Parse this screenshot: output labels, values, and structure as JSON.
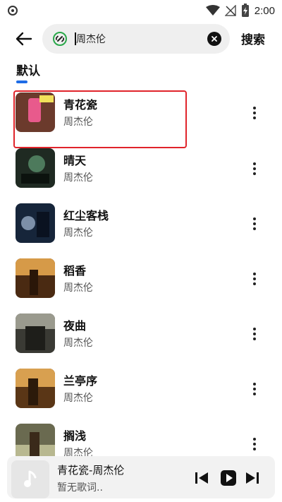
{
  "status_bar": {
    "time": "2:00"
  },
  "search": {
    "query": "周杰伦",
    "submit_label": "搜索"
  },
  "tabs": [
    {
      "label": "默认"
    }
  ],
  "songs": [
    {
      "title": "青花瓷",
      "artist": "周杰伦",
      "cover_color": "#6b3a2c",
      "cover_accent": "#e85a8c"
    },
    {
      "title": "晴天",
      "artist": "周杰伦",
      "cover_color": "#1f2a22",
      "cover_accent": "#4d7a5c"
    },
    {
      "title": "红尘客栈",
      "artist": "周杰伦",
      "cover_color": "#16253a",
      "cover_accent": "#7c8fa8"
    },
    {
      "title": "稻香",
      "artist": "周杰伦",
      "cover_color": "#4a2a12",
      "cover_accent": "#d69a48"
    },
    {
      "title": "夜曲",
      "artist": "周杰伦",
      "cover_color": "#3a3a34",
      "cover_accent": "#9a9a8e"
    },
    {
      "title": "兰亭序",
      "artist": "周杰伦",
      "cover_color": "#5a3616",
      "cover_accent": "#d8a050"
    },
    {
      "title": "搁浅",
      "artist": "周杰伦",
      "cover_color": "#6a6a50",
      "cover_accent": "#b8b890"
    }
  ],
  "player": {
    "now_playing": "青花瓷-周杰伦",
    "lyrics": "暂无歌词.."
  },
  "colors": {
    "tab_accent": "#1e6ce6",
    "highlight_border": "#e0242b"
  }
}
